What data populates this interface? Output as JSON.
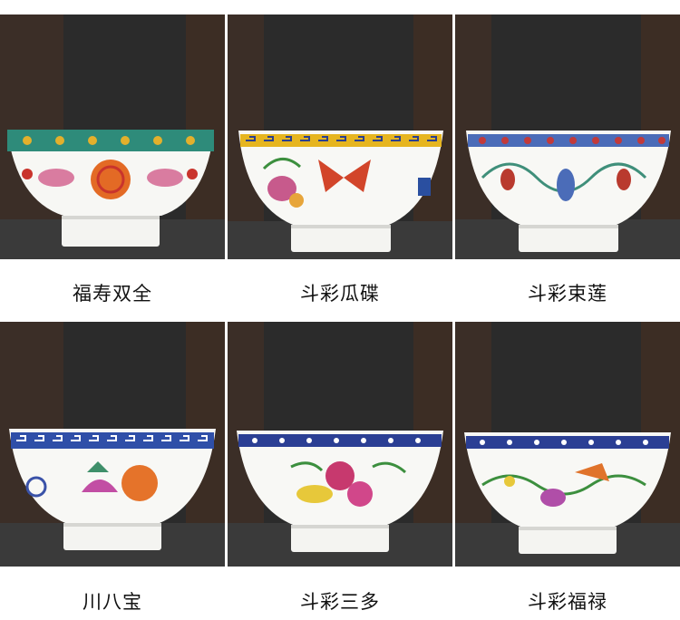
{
  "products": [
    {
      "label": "福寿双全",
      "rim": "#2e8b7a",
      "rim_accent": "#e3b02c",
      "motif": "#c9342c",
      "motif2": "#d97ca0"
    },
    {
      "label": "斗彩瓜碟",
      "rim": "#e6b51f",
      "rim_accent": "#2a3f8f",
      "motif": "#d2452a",
      "motif2": "#3c8f3e"
    },
    {
      "label": "斗彩束莲",
      "rim": "#4b6cb8",
      "rim_accent": "#c23a3a",
      "motif": "#3f8f7a",
      "motif2": "#b93a2e"
    },
    {
      "label": "川八宝",
      "rim": "#2f4fa8",
      "rim_accent": "#ffffff",
      "motif": "#e5732a",
      "motif2": "#c24ea4"
    },
    {
      "label": "斗彩三多",
      "rim": "#2b3f94",
      "rim_accent": "#ffffff",
      "motif": "#c7396e",
      "motif2": "#e7c83a"
    },
    {
      "label": "斗彩福禄",
      "rim": "#2b3f94",
      "rim_accent": "#ffffff",
      "motif": "#e0732b",
      "motif2": "#b04ea8"
    }
  ],
  "background": {
    "dark": "#2a2a2a",
    "wood": "#4a3528",
    "table": "#3a3a3a"
  }
}
